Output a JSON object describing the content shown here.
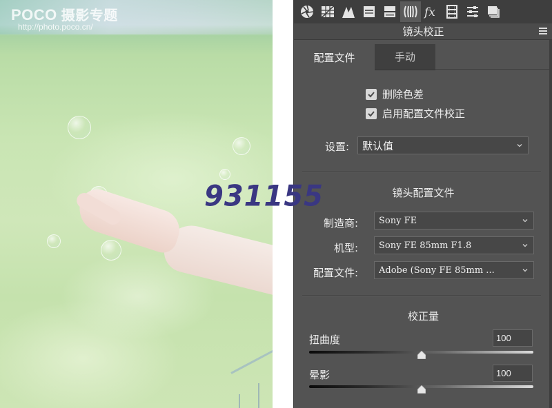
{
  "photo": {
    "watermark_brand": "POCO",
    "watermark_brand_cn": "摄影专题",
    "watermark_url": "http://photo.poco.cn/",
    "overlay_number": "931155",
    "overlay_color": "#3a3782"
  },
  "toolbar": {
    "icons": [
      {
        "name": "aperture-icon",
        "label": "基本"
      },
      {
        "name": "tone-curve-icon",
        "label": "色调曲线"
      },
      {
        "name": "detail-icon",
        "label": "细节"
      },
      {
        "name": "hsl-icon",
        "label": "HSL/灰度"
      },
      {
        "name": "split-toning-icon",
        "label": "分离色调"
      },
      {
        "name": "lens-correction-icon",
        "label": "镜头校正",
        "active": true
      },
      {
        "name": "fx-icon",
        "label": "效果"
      },
      {
        "name": "camera-calibration-icon",
        "label": "相机校准"
      },
      {
        "name": "presets-icon",
        "label": "预设"
      },
      {
        "name": "snapshots-icon",
        "label": "快照"
      }
    ]
  },
  "panel": {
    "title": "镜头校正",
    "tabs": [
      {
        "label": "配置文件",
        "active": true
      },
      {
        "label": "手动",
        "active": false
      }
    ],
    "checkboxes": [
      {
        "label": "删除色差",
        "checked": true
      },
      {
        "label": "启用配置文件校正",
        "checked": true
      }
    ],
    "setup": {
      "label": "设置:",
      "value": "默认值"
    },
    "lens_profile": {
      "title": "镜头配置文件",
      "make": {
        "label": "制造商:",
        "value": "Sony FE"
      },
      "model": {
        "label": "机型:",
        "value": "Sony FE 85mm F1.8"
      },
      "profile": {
        "label": "配置文件:",
        "value": "Adobe (Sony FE 85mm ..."
      }
    },
    "amount": {
      "title": "校正量",
      "distortion": {
        "label": "扭曲度",
        "value": "100",
        "slider_fraction": 0.5
      },
      "vignetting": {
        "label": "晕影",
        "value": "100",
        "slider_fraction": 0.5
      }
    }
  }
}
